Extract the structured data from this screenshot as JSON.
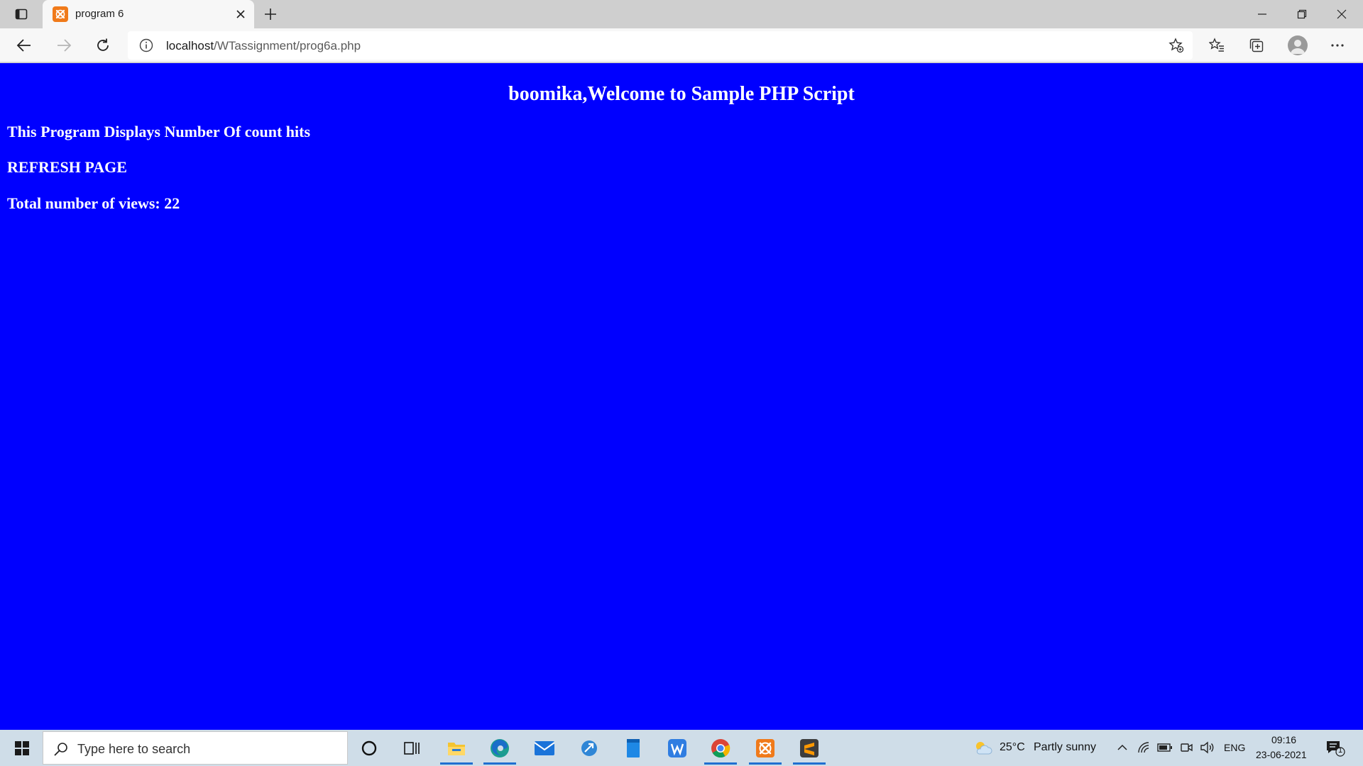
{
  "browser": {
    "tab": {
      "title": "program 6"
    },
    "address_bar": {
      "host": "localhost",
      "path": "/WTassignment/prog6a.php"
    }
  },
  "page": {
    "heading": "boomika,Welcome to Sample PHP Script",
    "line1": "This Program Displays Number Of count hits",
    "line2": "REFRESH PAGE",
    "line3_label": "Total number of views: ",
    "line3_count": "22",
    "background_color": "#0000ff"
  },
  "taskbar": {
    "search_placeholder": "Type here to search",
    "weather": {
      "temp": "25°C",
      "condition": "Partly sunny"
    },
    "language": "ENG",
    "time": "09:16",
    "date": "23-06-2021",
    "notification_count": "1",
    "pinned": [
      "cortana-icon",
      "task-view-icon",
      "file-explorer-icon",
      "edge-icon",
      "mail-icon",
      "vpn-icon",
      "notepad-icon",
      "wps-writer-icon",
      "chrome-icon",
      "xampp-icon",
      "sublime-text-icon"
    ]
  }
}
